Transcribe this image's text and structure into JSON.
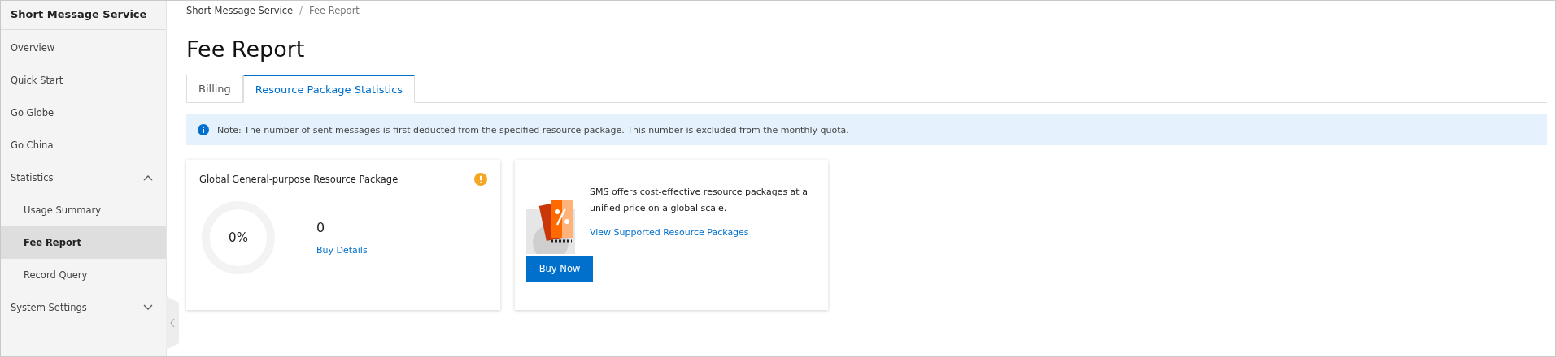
{
  "sidebar": {
    "title": "Short Message Service",
    "items": [
      {
        "label": "Overview",
        "selected": false
      },
      {
        "label": "Quick Start",
        "selected": false
      },
      {
        "label": "Go Globe",
        "selected": false
      },
      {
        "label": "Go China",
        "selected": false
      },
      {
        "label": "Statistics",
        "selected": false,
        "expanded": true,
        "children": [
          {
            "label": "Usage Summary",
            "selected": false
          },
          {
            "label": "Fee Report",
            "selected": true
          },
          {
            "label": "Record Query",
            "selected": false
          }
        ]
      },
      {
        "label": "System Settings",
        "selected": false,
        "expanded": false
      }
    ]
  },
  "breadcrumb": [
    "Short Message Service",
    "Fee Report"
  ],
  "breadcrumb_separator": "/",
  "title": "Fee Report",
  "tabs": [
    {
      "label": "Billing",
      "selected": false
    },
    {
      "label": "Resource Package Statistics",
      "selected": true
    }
  ],
  "notice": "Note: The number of sent messages is first deducted from the specified resource package. This number is excluded from the monthly quota.",
  "package_card": {
    "title": "Global General-purpose Resource Package",
    "percent": "0%",
    "count": "0",
    "link": "Buy Details"
  },
  "promo_card": {
    "text": "SMS offers cost-effective resource packages at a unified price on a global scale.",
    "link": "View Supported Resource Packages",
    "button": "Buy Now"
  }
}
